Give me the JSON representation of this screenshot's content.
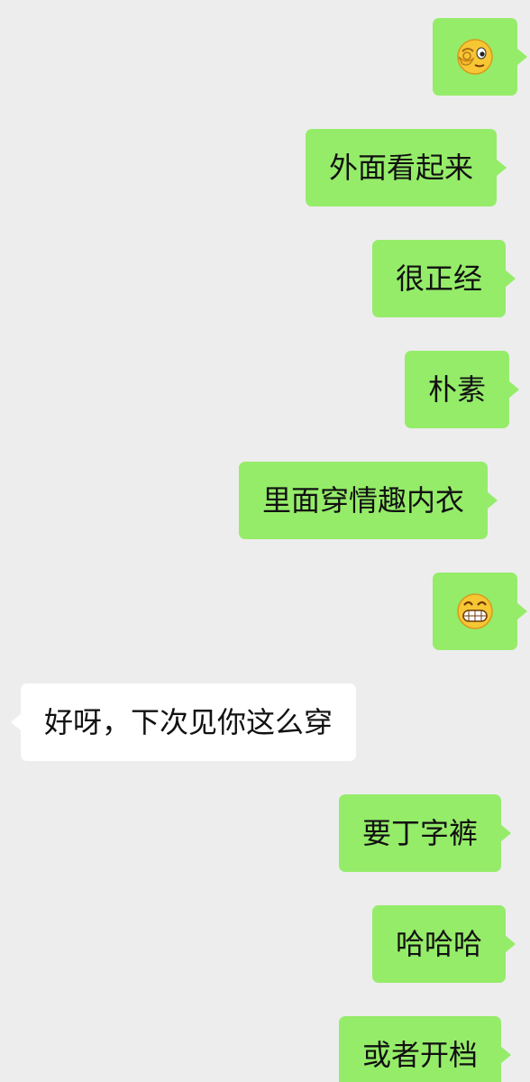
{
  "messages": [
    {
      "side": "sent",
      "type": "emoji",
      "emoji": "wink-ok-face-emoji"
    },
    {
      "side": "sent",
      "type": "text",
      "text": "外面看起来"
    },
    {
      "side": "sent",
      "type": "text",
      "text": "很正经"
    },
    {
      "side": "sent",
      "type": "text",
      "text": "朴素"
    },
    {
      "side": "sent",
      "type": "text",
      "text": "里面穿情趣内衣"
    },
    {
      "side": "sent",
      "type": "emoji",
      "emoji": "grinning-teeth-emoji"
    },
    {
      "side": "received",
      "type": "text",
      "text": "好呀，下次见你这么穿"
    },
    {
      "side": "sent",
      "type": "text",
      "text": "要丁字裤"
    },
    {
      "side": "sent",
      "type": "text",
      "text": "哈哈哈"
    },
    {
      "side": "sent",
      "type": "text",
      "text": "或者开档"
    }
  ],
  "colors": {
    "background": "#ededed",
    "sent_bubble": "#95ec69",
    "received_bubble": "#ffffff",
    "text": "#111111"
  }
}
